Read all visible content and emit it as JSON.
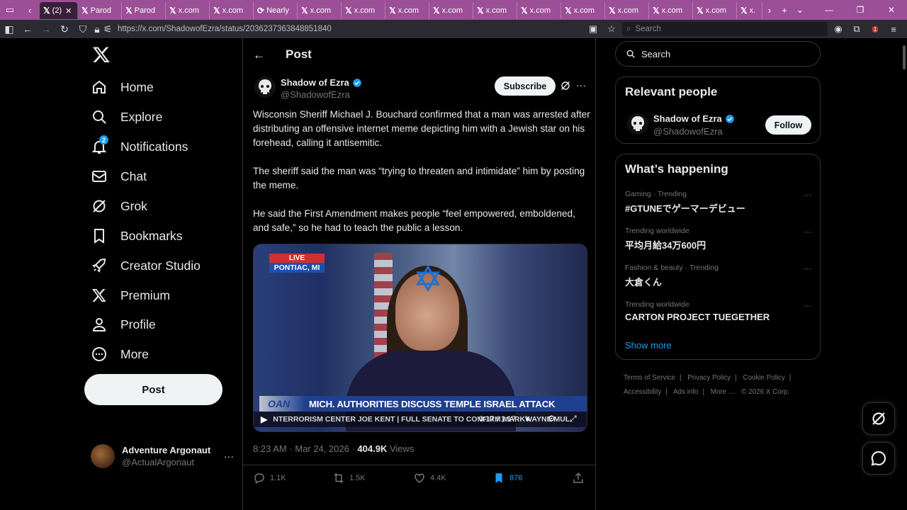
{
  "browser": {
    "tabs": [
      {
        "label": "(2)",
        "active": true
      },
      {
        "label": "Parod"
      },
      {
        "label": "Parod"
      },
      {
        "label": "x.com"
      },
      {
        "label": "x.com"
      },
      {
        "label": "Nearly"
      },
      {
        "label": "x.com"
      },
      {
        "label": "x.com"
      },
      {
        "label": "x.com"
      },
      {
        "label": "x.com"
      },
      {
        "label": "x.com"
      },
      {
        "label": "x.com"
      },
      {
        "label": "x.com"
      },
      {
        "label": "x.com"
      },
      {
        "label": "x.com"
      },
      {
        "label": "x.com"
      },
      {
        "label": "x."
      }
    ],
    "url": "https://x.com/ShadowofEzra/status/2036237363848851840",
    "search_placeholder": "Search",
    "extension_badge": "1",
    "tabbar_color": "#9b4f96"
  },
  "sidebar": {
    "items": [
      {
        "label": "Home",
        "icon": "home-icon"
      },
      {
        "label": "Explore",
        "icon": "search-icon"
      },
      {
        "label": "Notifications",
        "icon": "bell-icon",
        "badge": "2"
      },
      {
        "label": "Chat",
        "icon": "mail-icon"
      },
      {
        "label": "Grok",
        "icon": "grok-icon"
      },
      {
        "label": "Bookmarks",
        "icon": "bookmark-icon"
      },
      {
        "label": "Creator Studio",
        "icon": "rocket-icon"
      },
      {
        "label": "Premium",
        "icon": "x-logo-icon"
      },
      {
        "label": "Profile",
        "icon": "person-icon"
      },
      {
        "label": "More",
        "icon": "more-circle-icon"
      }
    ],
    "post_button": "Post",
    "account": {
      "name": "Adventure Argonaut",
      "handle": "@ActualArgonaut"
    }
  },
  "main": {
    "header_title": "Post",
    "author": {
      "name": "Shadow of Ezra",
      "handle": "@ShadowofEzra"
    },
    "subscribe_label": "Subscribe",
    "paragraphs": [
      "Wisconsin Sheriff Michael J. Bouchard confirmed that a man was arrested after distributing an offensive internet meme depicting him with a Jewish star on his forehead, calling it antisemitic.",
      "The sheriff said the man was “trying to threaten and intimidate” him by posting the meme.",
      "He said the First Amendment makes people “feel empowered, emboldened, and safe,” so he had to teach the public a lesson."
    ],
    "video": {
      "live_label": "LIVE",
      "location": "PONTIAC, MI",
      "channel": "OAN",
      "headline": "MICH. AUTHORITIES DISCUSS TEMPLE ISRAEL ATTACK",
      "ticker": "NTERRORISM CENTER JOE KENT  |  FULL SENATE TO CONFIRM MARKWAYNE MUL",
      "time": "0:17 / 1:17",
      "progress": 0.22
    },
    "meta": {
      "time": "8:23 AM · Mar 24, 2026 ·",
      "views_count": "404.9K",
      "views_label": "Views"
    },
    "actions": {
      "replies": "1.1K",
      "reposts": "1.5K",
      "likes": "4.4K",
      "bookmarks": "876"
    }
  },
  "right": {
    "search_placeholder": "Search",
    "relevant_title": "Relevant people",
    "relevant_person": {
      "name": "Shadow of Ezra",
      "handle": "@ShadowofEzra",
      "follow_label": "Follow"
    },
    "happening_title": "What’s happening",
    "trends": [
      {
        "context": "Gaming · Trending",
        "title": "#GTUNEでゲーマーデビュー"
      },
      {
        "context": "Trending worldwide",
        "title": "平均月給34万600円"
      },
      {
        "context": "Fashion & beauty · Trending",
        "title": "大倉くん"
      },
      {
        "context": "Trending worldwide",
        "title": "CARTON PROJECT TUEGETHER"
      }
    ],
    "show_more": "Show more",
    "footer": [
      "Terms of Service",
      "Privacy Policy",
      "Cookie Policy",
      "Accessibility",
      "Ads info",
      "More …",
      "© 2026 X Corp."
    ]
  }
}
